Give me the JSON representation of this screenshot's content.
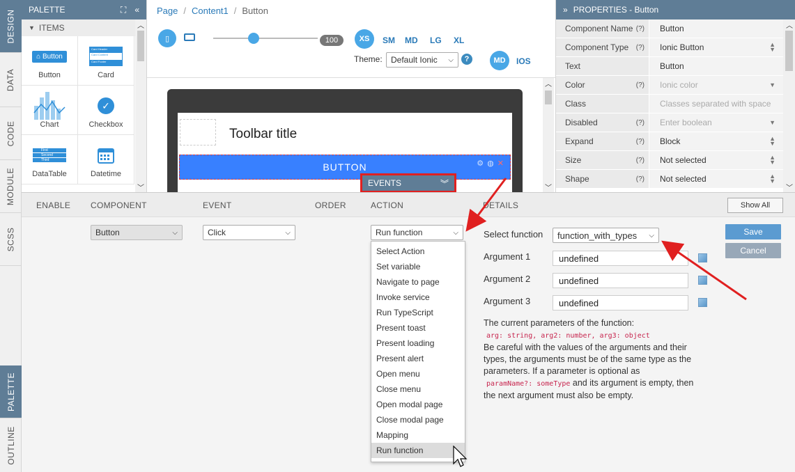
{
  "left_tabs": {
    "design": "DESIGN",
    "data": "DATA",
    "code": "CODE",
    "module": "MODULE",
    "scss": "SCSS",
    "palette": "PALETTE",
    "outline": "OUTLINE"
  },
  "palette": {
    "title": "PALETTE",
    "section": "ITEMS",
    "items": [
      {
        "label": "Button",
        "icon": "button-preview-icon",
        "mini_text": "Button"
      },
      {
        "label": "Card",
        "icon": "card-preview-icon"
      },
      {
        "label": "Chart",
        "icon": "chart-preview-icon"
      },
      {
        "label": "Checkbox",
        "icon": "checkbox-icon"
      },
      {
        "label": "DataTable",
        "icon": "datatable-preview-icon"
      },
      {
        "label": "Datetime",
        "icon": "calendar-icon"
      }
    ],
    "card_mini": [
      "Card Header",
      "Card Content",
      "Card Footer"
    ],
    "datatable_mini": [
      "First",
      "Second",
      "Third"
    ]
  },
  "breadcrumb": {
    "items": [
      "Page",
      "Content1",
      "Button"
    ],
    "separator": "/"
  },
  "device_bar": {
    "slider_value": "100",
    "sizes": [
      "XS",
      "SM",
      "MD",
      "LG",
      "XL"
    ],
    "theme_label": "Theme:",
    "theme_value": "Default Ionic",
    "help": "?",
    "platform_md": "MD",
    "platform_ios": "IOS"
  },
  "canvas": {
    "toolbar_title": "Toolbar title",
    "button_text": "BUTTON",
    "events_tag": "EVENTS"
  },
  "properties": {
    "title": "PROPERTIES - Button",
    "rows": [
      {
        "name": "Component Name",
        "help": "(?)",
        "value": "Button",
        "placeholder": false,
        "control": ""
      },
      {
        "name": "Component Type",
        "help": "(?)",
        "value": "Ionic Button",
        "placeholder": false,
        "control": "updown"
      },
      {
        "name": "Text",
        "help": "",
        "value": "Button",
        "placeholder": false,
        "control": ""
      },
      {
        "name": "Color",
        "help": "(?)",
        "value": "Ionic color",
        "placeholder": true,
        "control": "dropdown"
      },
      {
        "name": "Class",
        "help": "",
        "value": "Classes separated with space",
        "placeholder": true,
        "control": ""
      },
      {
        "name": "Disabled",
        "help": "(?)",
        "value": "Enter boolean",
        "placeholder": true,
        "control": "dropdown"
      },
      {
        "name": "Expand",
        "help": "(?)",
        "value": "Block",
        "placeholder": false,
        "control": "updown"
      },
      {
        "name": "Size",
        "help": "(?)",
        "value": "Not selected",
        "placeholder": false,
        "control": "updown"
      },
      {
        "name": "Shape",
        "help": "(?)",
        "value": "Not selected",
        "placeholder": false,
        "control": "updown"
      }
    ]
  },
  "events": {
    "columns": {
      "enable": "ENABLE",
      "component": "COMPONENT",
      "event": "EVENT",
      "order": "ORDER",
      "action": "ACTION",
      "details": "DETAILS"
    },
    "show_all": "Show All",
    "row": {
      "component": "Button",
      "event": "Click",
      "action": "Run function"
    },
    "action_options": [
      "Select Action",
      "Set variable",
      "Navigate to page",
      "Invoke service",
      "Run TypeScript",
      "Present toast",
      "Present loading",
      "Present alert",
      "Open menu",
      "Close menu",
      "Open modal page",
      "Close modal page",
      "Mapping",
      "Run function"
    ],
    "highlighted_option": "Run function",
    "details": {
      "select_function_label": "Select function",
      "select_function_value": "function_with_types",
      "arguments": [
        {
          "label": "Argument 1",
          "value": "undefined"
        },
        {
          "label": "Argument 2",
          "value": "undefined"
        },
        {
          "label": "Argument 3",
          "value": "undefined"
        }
      ],
      "note_intro": "The current parameters of the function:",
      "note_signature": "arg: string, arg2: number, arg3: object",
      "note_text1": "Be careful with the values of the arguments and their types, the arguments must be of the same type as the parameters. If a parameter is optional as",
      "note_code2": "paramName?: someType",
      "note_text2": "and its argument is empty, then the next argument must also be empty."
    },
    "save": "Save",
    "cancel": "Cancel"
  },
  "colors": {
    "accent": "#5f7d96",
    "link": "#2a7ab8",
    "primary_button": "#3880ff",
    "save": "#5b9bd1",
    "cancel": "#98a8b8",
    "highlight_red": "#e02020"
  }
}
